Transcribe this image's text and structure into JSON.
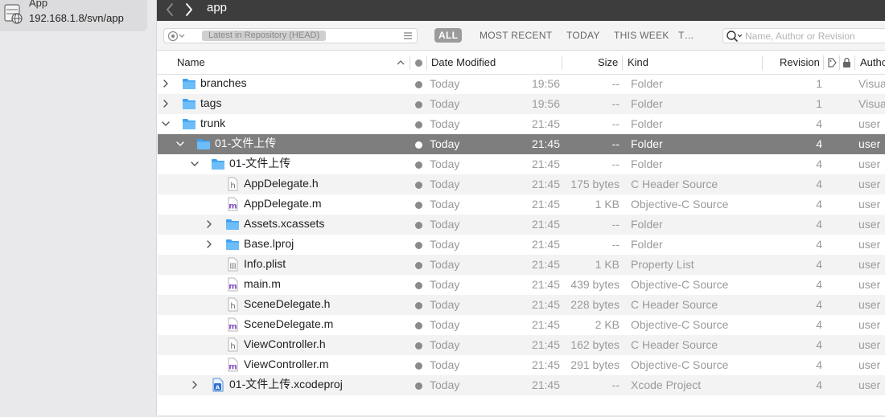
{
  "sidebar": {
    "repo_name": "App",
    "repo_url": "192.168.1.8/svn/app"
  },
  "titlebar": {
    "title": "app"
  },
  "filterbar": {
    "revision_label": "Latest in Repository (HEAD)",
    "tabs": [
      "ALL",
      "MOST RECENT",
      "TODAY",
      "THIS WEEK",
      "T…"
    ],
    "active_tab": "ALL",
    "search_placeholder": "Name, Author or Revision"
  },
  "columns": {
    "name": "Name",
    "date_modified": "Date Modified",
    "size": "Size",
    "kind": "Kind",
    "revision": "Revision",
    "author": "Autho"
  },
  "rows": [
    {
      "name": "branches",
      "date": "Today",
      "time": "19:56",
      "size": "--",
      "kind": "Folder",
      "revision": "1",
      "author": "Visua",
      "depth": 0,
      "icon": "folder-icon",
      "disclosure": "collapsed"
    },
    {
      "name": "tags",
      "date": "Today",
      "time": "19:56",
      "size": "--",
      "kind": "Folder",
      "revision": "1",
      "author": "Visua",
      "depth": 0,
      "icon": "folder-icon",
      "disclosure": "collapsed"
    },
    {
      "name": "trunk",
      "date": "Today",
      "time": "21:45",
      "size": "--",
      "kind": "Folder",
      "revision": "4",
      "author": "user",
      "depth": 0,
      "icon": "folder-icon",
      "disclosure": "expanded"
    },
    {
      "name": "01-文件上传",
      "date": "Today",
      "time": "21:45",
      "size": "--",
      "kind": "Folder",
      "revision": "4",
      "author": "user",
      "depth": 1,
      "icon": "folder-icon",
      "disclosure": "expanded",
      "selected": true
    },
    {
      "name": "01-文件上传",
      "date": "Today",
      "time": "21:45",
      "size": "--",
      "kind": "Folder",
      "revision": "4",
      "author": "user",
      "depth": 2,
      "icon": "folder-icon",
      "disclosure": "expanded"
    },
    {
      "name": "AppDelegate.h",
      "date": "Today",
      "time": "21:45",
      "size": "175 bytes",
      "kind": "C Header Source",
      "revision": "4",
      "author": "user",
      "depth": 3,
      "icon": "header-file-icon",
      "disclosure": "none"
    },
    {
      "name": "AppDelegate.m",
      "date": "Today",
      "time": "21:45",
      "size": "1 KB",
      "kind": "Objective-C Source",
      "revision": "4",
      "author": "user",
      "depth": 3,
      "icon": "objc-file-icon",
      "disclosure": "none"
    },
    {
      "name": "Assets.xcassets",
      "date": "Today",
      "time": "21:45",
      "size": "--",
      "kind": "Folder",
      "revision": "4",
      "author": "user",
      "depth": 3,
      "icon": "folder-icon",
      "disclosure": "collapsed"
    },
    {
      "name": "Base.lproj",
      "date": "Today",
      "time": "21:45",
      "size": "--",
      "kind": "Folder",
      "revision": "4",
      "author": "user",
      "depth": 3,
      "icon": "folder-icon",
      "disclosure": "collapsed"
    },
    {
      "name": "Info.plist",
      "date": "Today",
      "time": "21:45",
      "size": "1 KB",
      "kind": "Property List",
      "revision": "4",
      "author": "user",
      "depth": 3,
      "icon": "plist-file-icon",
      "disclosure": "none"
    },
    {
      "name": "main.m",
      "date": "Today",
      "time": "21:45",
      "size": "439 bytes",
      "kind": "Objective-C Source",
      "revision": "4",
      "author": "user",
      "depth": 3,
      "icon": "objc-file-icon",
      "disclosure": "none"
    },
    {
      "name": "SceneDelegate.h",
      "date": "Today",
      "time": "21:45",
      "size": "228 bytes",
      "kind": "C Header Source",
      "revision": "4",
      "author": "user",
      "depth": 3,
      "icon": "header-file-icon",
      "disclosure": "none"
    },
    {
      "name": "SceneDelegate.m",
      "date": "Today",
      "time": "21:45",
      "size": "2 KB",
      "kind": "Objective-C Source",
      "revision": "4",
      "author": "user",
      "depth": 3,
      "icon": "objc-file-icon",
      "disclosure": "none"
    },
    {
      "name": "ViewController.h",
      "date": "Today",
      "time": "21:45",
      "size": "162 bytes",
      "kind": "C Header Source",
      "revision": "4",
      "author": "user",
      "depth": 3,
      "icon": "header-file-icon",
      "disclosure": "none"
    },
    {
      "name": "ViewController.m",
      "date": "Today",
      "time": "21:45",
      "size": "291 bytes",
      "kind": "Objective-C Source",
      "revision": "4",
      "author": "user",
      "depth": 3,
      "icon": "objc-file-icon",
      "disclosure": "none"
    },
    {
      "name": "01-文件上传.xcodeproj",
      "date": "Today",
      "time": "21:45",
      "size": "--",
      "kind": "Xcode Project",
      "revision": "4",
      "author": "user",
      "depth": 2,
      "icon": "xcodeproj-icon",
      "disclosure": "collapsed"
    }
  ],
  "colors": {
    "selected_row": "#7e7e7e",
    "folder_blue": "#3ea0f2",
    "objc_purple": "#8a4fc7",
    "titlebar": "#3d3d3d"
  }
}
